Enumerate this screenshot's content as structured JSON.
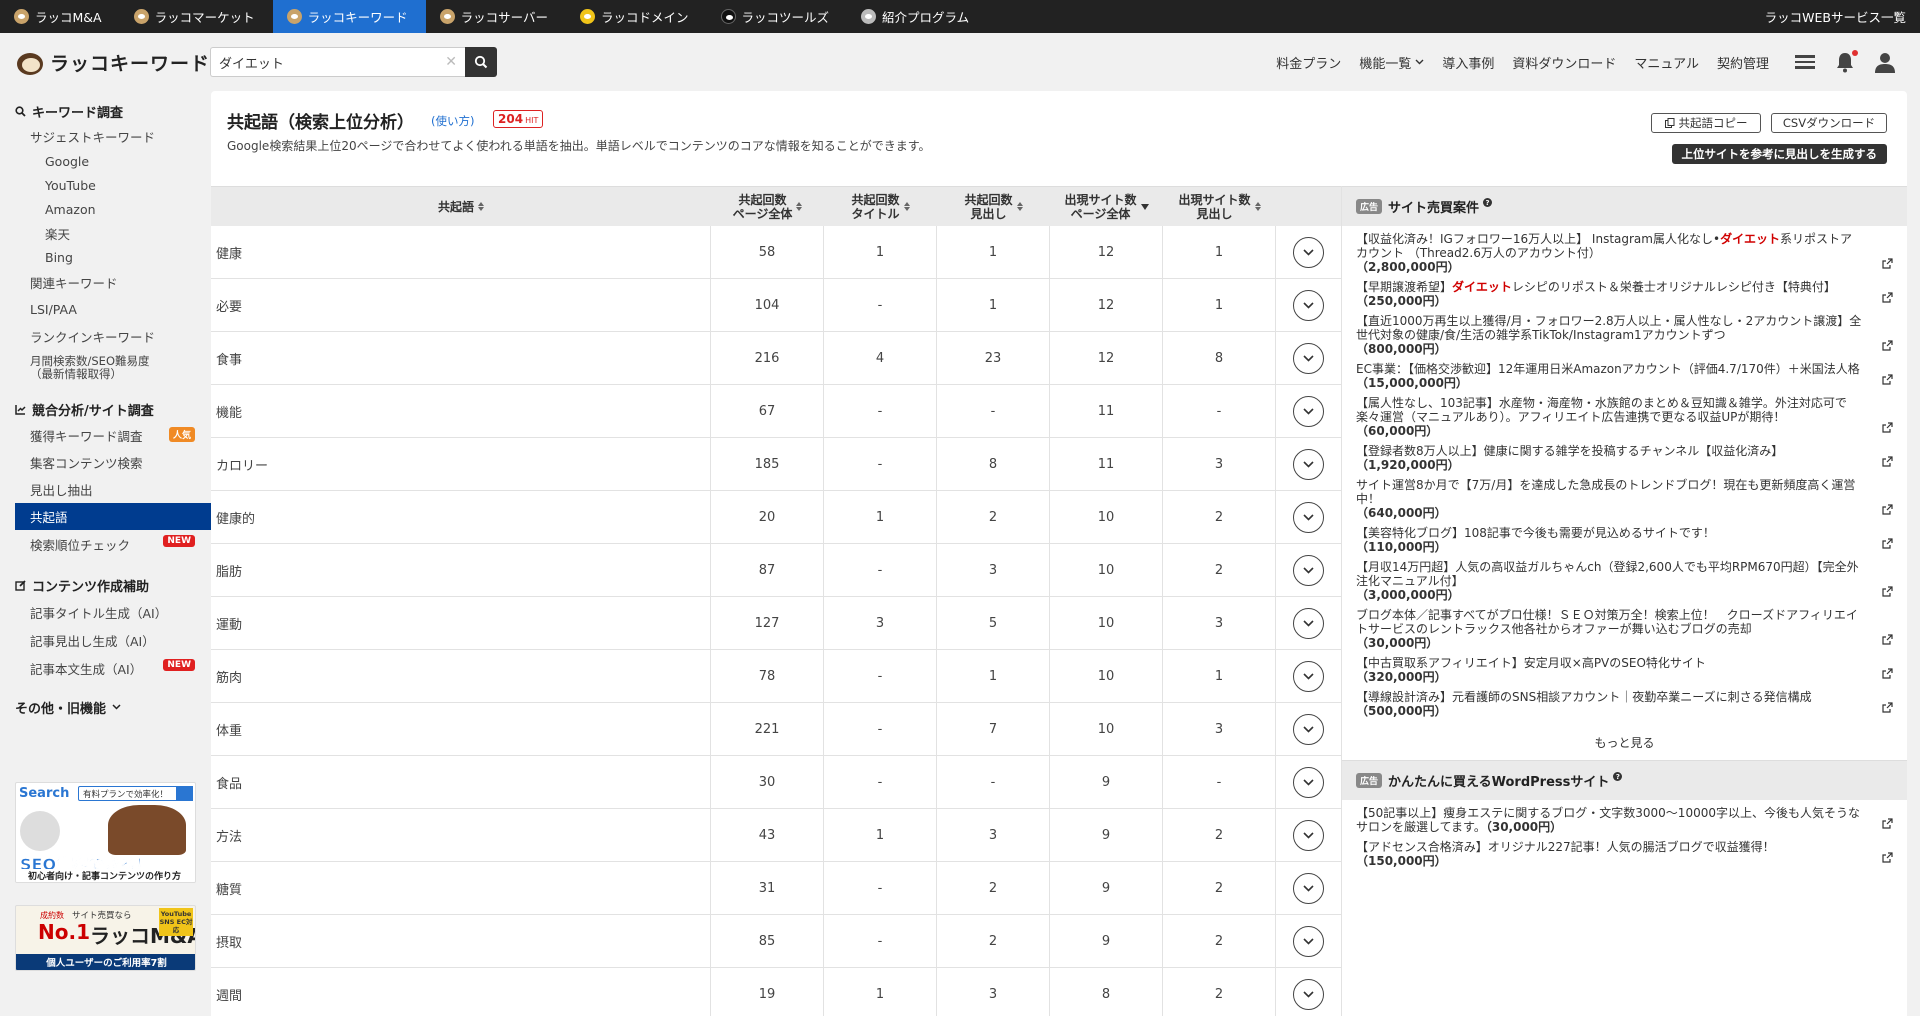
{
  "topnav": {
    "items": [
      {
        "label": "ラッコM&A",
        "icon": "otter-icon"
      },
      {
        "label": "ラッコマーケット",
        "icon": "otter-icon"
      },
      {
        "label": "ラッコキーワード",
        "icon": "otter-icon",
        "active": true
      },
      {
        "label": "ラッコサーバー",
        "icon": "otter-icon"
      },
      {
        "label": "ラッコドメイン",
        "icon": "otter-icon"
      },
      {
        "label": "ラッコツールズ",
        "icon": "otter-icon"
      },
      {
        "label": "紹介プログラム",
        "icon": "otter-icon"
      }
    ],
    "services": "ラッコWEBサービス一覧"
  },
  "header": {
    "logo": "ラッコキーワード",
    "search_value": "ダイエット",
    "nav": [
      "料金プラン",
      "機能一覧",
      "導入事例",
      "資料ダウンロード",
      "マニュアル",
      "契約管理"
    ]
  },
  "sidebar": {
    "sections": {
      "keyword": "キーワード調査",
      "competitor": "競合分析/サイト調査",
      "content": "コンテンツ作成補助",
      "other": "その他・旧機能"
    },
    "keyword_items": {
      "suggest": "サジェストキーワード",
      "google": "Google",
      "youtube": "YouTube",
      "amazon": "Amazon",
      "rakuten": "楽天",
      "bing": "Bing",
      "related": "関連キーワード",
      "lsi": "LSI/PAA",
      "rankin": "ランクインキーワード",
      "monthly1": "月間検索数/SEO難易度",
      "monthly2": "（最新情報取得）"
    },
    "competitor_items": {
      "acquired": "獲得キーワード調査",
      "acquired_badge": "人気",
      "content_search": "集客コンテンツ検索",
      "headings": "見出し抽出",
      "cooccur": "共起語",
      "rank_check": "検索順位チェック",
      "rank_badge": "NEW"
    },
    "content_items": {
      "title_gen": "記事タイトル生成（AI）",
      "heading_gen": "記事見出し生成（AI）",
      "body_gen": "記事本文生成（AI）",
      "body_badge": "NEW"
    },
    "banner1": {
      "search": "Search",
      "pill": "有料プランで効率化！",
      "big": "SEO集客できる！",
      "sub": "初心者向け・記事コンテンツの作り方"
    },
    "banner2": {
      "small": "サイト売買なら",
      "rank": "成約数",
      "no1": "No.1",
      "brand": "ラッコM&A",
      "corner": "YouTube SNS EC対応",
      "bottom": "個人ユーザーのご利用率7割"
    }
  },
  "main": {
    "title": "共起語（検索上位分析）",
    "usage": "(使い方)",
    "hits": "204",
    "hits_unit": "HIT",
    "description": "Google検索結果上位20ページで合わせてよく使われる単語を抽出。単語レベルでコンテンツのコアな情報を知ることができます。",
    "copy_button": "共起語コピー",
    "csv_button": "CSVダウンロード",
    "generate_button": "上位サイトを参考に見出しを生成する"
  },
  "table": {
    "headers": [
      {
        "line1": "共起語",
        "line2": ""
      },
      {
        "line1": "共起回数",
        "line2": "ページ全体"
      },
      {
        "line1": "共起回数",
        "line2": "タイトル"
      },
      {
        "line1": "共起回数",
        "line2": "見出し"
      },
      {
        "line1": "出現サイト数",
        "line2": "ページ全体"
      },
      {
        "line1": "出現サイト数",
        "line2": "見出し"
      }
    ],
    "rows": [
      [
        "健康",
        "58",
        "1",
        "1",
        "12",
        "1"
      ],
      [
        "必要",
        "104",
        "-",
        "1",
        "12",
        "1"
      ],
      [
        "食事",
        "216",
        "4",
        "23",
        "12",
        "8"
      ],
      [
        "機能",
        "67",
        "-",
        "-",
        "11",
        "-"
      ],
      [
        "カロリー",
        "185",
        "-",
        "8",
        "11",
        "3"
      ],
      [
        "健康的",
        "20",
        "1",
        "2",
        "10",
        "2"
      ],
      [
        "脂肪",
        "87",
        "-",
        "3",
        "10",
        "2"
      ],
      [
        "運動",
        "127",
        "3",
        "5",
        "10",
        "3"
      ],
      [
        "筋肉",
        "78",
        "-",
        "1",
        "10",
        "1"
      ],
      [
        "体重",
        "221",
        "-",
        "7",
        "10",
        "3"
      ],
      [
        "食品",
        "30",
        "-",
        "-",
        "9",
        "-"
      ],
      [
        "方法",
        "43",
        "1",
        "3",
        "9",
        "2"
      ],
      [
        "糖質",
        "31",
        "-",
        "2",
        "9",
        "2"
      ],
      [
        "摂取",
        "85",
        "-",
        "2",
        "9",
        "2"
      ],
      [
        "週間",
        "19",
        "1",
        "3",
        "8",
        "2"
      ]
    ]
  },
  "rightpanel": {
    "ad_label": "広告",
    "section1_title": "サイト売買案件",
    "listings": [
      {
        "pre": "【収益化済み！IGフォロワー16万人以上】 Instagram属人化なし•",
        "hl": "ダイエット",
        "post": "系リポストアカウント （Thread2.6万人のアカウント付）",
        "price": "（2,800,000円）"
      },
      {
        "pre": "【早期譲渡希望】",
        "hl": "ダイエット",
        "post": "レシピのリポスト＆栄養士オリジナルレシピ付き【特典付】",
        "price": "（250,000円）"
      },
      {
        "pre": "【直近1000万再生以上獲得/月・フォロワー2.8万人以上・属人性なし・2アカウント譲渡】全世代対象の健康/食/生活の雑学系TikTok/Instagram1アカウントずつ",
        "hl": "",
        "post": "",
        "price": "（800,000円）"
      },
      {
        "pre": "EC事業：【価格交渉歓迎】12年運用日米Amazonアカウント（評価4.7/170件）＋米国法人格",
        "hl": "",
        "post": "",
        "price": "（15,000,000円）"
      },
      {
        "pre": "【属人性なし、103記事】水産物・海産物・水族館のまとめ＆豆知識＆雑学。外注対応可で楽々運営（マニュアルあり）。アフィリエイト広告連携で更なる収益UPが期待！",
        "hl": "",
        "post": "",
        "price": "（60,000円）"
      },
      {
        "pre": "【登録者数8万人以上】健康に関する雑学を投稿するチャンネル【収益化済み】",
        "hl": "",
        "post": "",
        "price": "（1,920,000円）"
      },
      {
        "pre": "サイト運営8か月で【7万/月】を達成した急成長のトレンドブログ！現在も更新頻度高く運営中！",
        "hl": "",
        "post": "",
        "price": "（640,000円）"
      },
      {
        "pre": "【美容特化ブログ】108記事で今後も需要が見込めるサイトです！",
        "hl": "",
        "post": "",
        "price": "（110,000円）"
      },
      {
        "pre": "【月収14万円超】人気の高収益ガルちゃんch（登録2,600人でも平均RPM670円超）【完全外注化マニュアル付】",
        "hl": "",
        "post": "",
        "price": "（3,000,000円）"
      },
      {
        "pre": "ブログ本体／記事すべてがプロ仕様！ＳＥＯ対策万全！検索上位！　クローズドアフィリエイトサービスのレントラックス他各社からオファーが舞い込むブログの売却",
        "hl": "",
        "post": "",
        "price": "（30,000円）"
      },
      {
        "pre": "【中古買取系アフィリエイト】安定月収×高PVのSEO特化サイト",
        "hl": "",
        "post": "",
        "price": "（320,000円）"
      },
      {
        "pre": "【導線設計済み】元看護師のSNS相談アカウント｜夜勤卒業ニーズに刺さる発信構成",
        "hl": "",
        "post": "",
        "price": "（500,000円）"
      }
    ],
    "more": "もっと見る",
    "section2_title": "かんたんに買えるWordPressサイト",
    "wp_listings": [
      {
        "text": "【50記事以上】痩身エステに関するブログ・文字数3000〜10000字以上、今後も人気そうなサロンを厳選してます。",
        "price": "（30,000円）"
      },
      {
        "text": "【アドセンス合格済み】オリジナル227記事！人気の腸活ブログで収益獲得！",
        "price": "（150,000円）"
      }
    ]
  }
}
